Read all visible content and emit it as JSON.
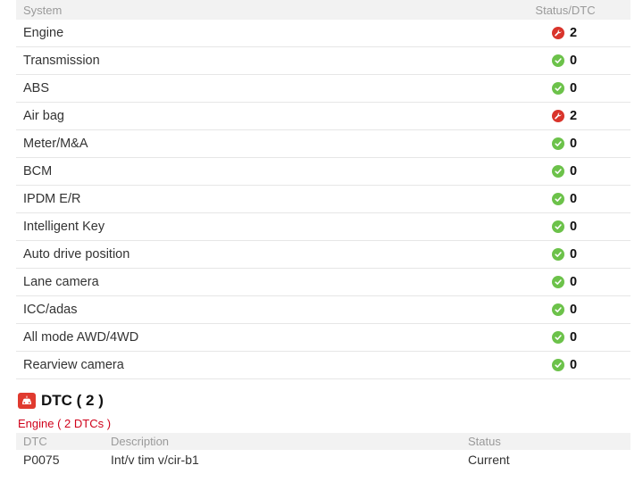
{
  "systems_header": {
    "system": "System",
    "status": "Status/DTC"
  },
  "systems": [
    {
      "name": "Engine",
      "state": "fault",
      "count": "2"
    },
    {
      "name": "Transmission",
      "state": "ok",
      "count": "0"
    },
    {
      "name": "ABS",
      "state": "ok",
      "count": "0"
    },
    {
      "name": "Air bag",
      "state": "fault",
      "count": "2"
    },
    {
      "name": "Meter/M&A",
      "state": "ok",
      "count": "0"
    },
    {
      "name": "BCM",
      "state": "ok",
      "count": "0"
    },
    {
      "name": "IPDM E/R",
      "state": "ok",
      "count": "0"
    },
    {
      "name": "Intelligent Key",
      "state": "ok",
      "count": "0"
    },
    {
      "name": "Auto drive position",
      "state": "ok",
      "count": "0"
    },
    {
      "name": "Lane camera",
      "state": "ok",
      "count": "0"
    },
    {
      "name": "ICC/adas",
      "state": "ok",
      "count": "0"
    },
    {
      "name": "All mode AWD/4WD",
      "state": "ok",
      "count": "0"
    },
    {
      "name": "Rearview camera",
      "state": "ok",
      "count": "0"
    }
  ],
  "icons": {
    "ok": "check-circle-icon",
    "fault": "wrench-circle-icon",
    "dtc": "warning-car-icon"
  },
  "colors": {
    "ok": "#6cc24a",
    "fault": "#d9342b",
    "engine_sub": "#d0021b"
  },
  "dtc_section": {
    "title": "DTC ( 2 )",
    "engine_label": "Engine ( 2 DTCs )",
    "headers": {
      "code": "DTC",
      "description": "Description",
      "status": "Status"
    },
    "rows": [
      {
        "code": "P0075",
        "description": "Int/v tim v/cir-b1",
        "status": "Current"
      }
    ]
  }
}
